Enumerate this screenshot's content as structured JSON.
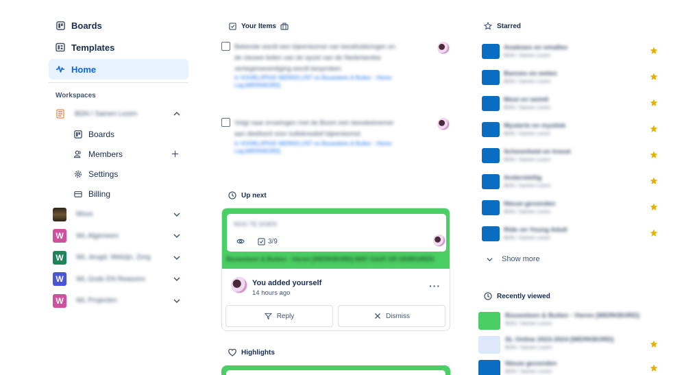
{
  "colors": {
    "accent": "#0c66e4",
    "activeBg": "#e9f2ff",
    "boardGreen": "#4bce63",
    "boardBlue": "#0a6dc2",
    "star": "#e2b203"
  },
  "sidebar": {
    "items": [
      {
        "label": "Boards",
        "icon": "board-icon"
      },
      {
        "label": "Templates",
        "icon": "template-icon"
      },
      {
        "label": "Home",
        "icon": "activity-icon",
        "active": true
      }
    ],
    "workspaces_title": "Workspaces",
    "current_workspace": {
      "name": "BDN / Samen Lezen",
      "sub_items": [
        {
          "label": "Boards",
          "icon": "board-icon"
        },
        {
          "label": "Members",
          "icon": "members-icon"
        },
        {
          "label": "Settings",
          "icon": "gear-icon"
        },
        {
          "label": "Billing",
          "icon": "card-icon"
        }
      ]
    },
    "other_workspaces": [
      {
        "name": "Mous",
        "logo": "",
        "color": "#5a4a2a"
      },
      {
        "name": "WL Algemeen",
        "logo": "W",
        "color": "#cd519d"
      },
      {
        "name": "WL Jeugd, Welzijn, Zorg",
        "logo": "W",
        "color": "#1f845a"
      },
      {
        "name": "WL Gods EN Reasonn",
        "logo": "W",
        "color": "#4a56d9"
      },
      {
        "name": "WL Projecten",
        "logo": "W",
        "color": "#cd519d"
      }
    ]
  },
  "main": {
    "your_items": {
      "title": "Your Items",
      "items": [
        {
          "text": "Bekende wordt een bijeenkomst van leesklubkringen en de nieuwe leden van de opzet van de Nederlandse vertegenwoordiging wordt besproken",
          "link": "in VOORLOPIGE WERKELIJST on Bouwsteen & Buiten - Vieren",
          "link2": "Leg [WERKBORD]"
        },
        {
          "text": "Volgt naar ervaringen met de Boom een leesdeelnemer aan deelbord voor ludiekreatief bijeenkomst",
          "link": "in VOORLOPIGE WERKELIJST on Bouwsteen & Buiten - Vieren",
          "link2": "Leg [WERKBORD]"
        }
      ]
    },
    "up_next": {
      "title": "Up next",
      "card_title": "NOG TE DOEN",
      "checklist": "3/9",
      "board_path": "Bouwsteen & Buiten - Vieren [WERKBORD] WAT GAAT ER GEBEUREN",
      "notification": "You added yourself",
      "time": "14 hours ago",
      "reply_label": "Reply",
      "dismiss_label": "Dismiss"
    },
    "highlights": {
      "title": "Highlights"
    }
  },
  "right": {
    "starred_title": "Starred",
    "starred": [
      {
        "name": "Analeses en emaltes",
        "ws": "BDN / Samen Lezen"
      },
      {
        "name": "Bannes en weten",
        "ws": "BDN / Samen Lezen"
      },
      {
        "name": "Mooi en weintl",
        "ws": "BDN / Samen Lezen"
      },
      {
        "name": "Mysterie en mystiek",
        "ws": "BDN / Samen Lezen"
      },
      {
        "name": "Schoonheid en troost",
        "ws": "BDN / Samen Lezen"
      },
      {
        "name": "Andersteltig",
        "ws": "BDN / Samen Lezen"
      },
      {
        "name": "Nieuw gevonden",
        "ws": "BDN / Samen Lezen"
      },
      {
        "name": "Ride on Young Adult",
        "ws": "BDN / Samen Lezen"
      }
    ],
    "show_more": "Show more",
    "recent_title": "Recently viewed",
    "recent": [
      {
        "name": "Bouwsteen & Buiten - Vieren [WERKBORD]",
        "ws": "BDN / Samen Lezen",
        "color": "#4bce63",
        "starred": false
      },
      {
        "name": "SL Online 2023-2024 [WERKBORD]",
        "ws": "BDN / Samen Lezen",
        "color": "#dde9fb",
        "starred": true
      },
      {
        "name": "Nieuw gevonden",
        "ws": "BDN / Samen Lezen",
        "color": "#0a6dc2",
        "starred": true
      }
    ]
  }
}
